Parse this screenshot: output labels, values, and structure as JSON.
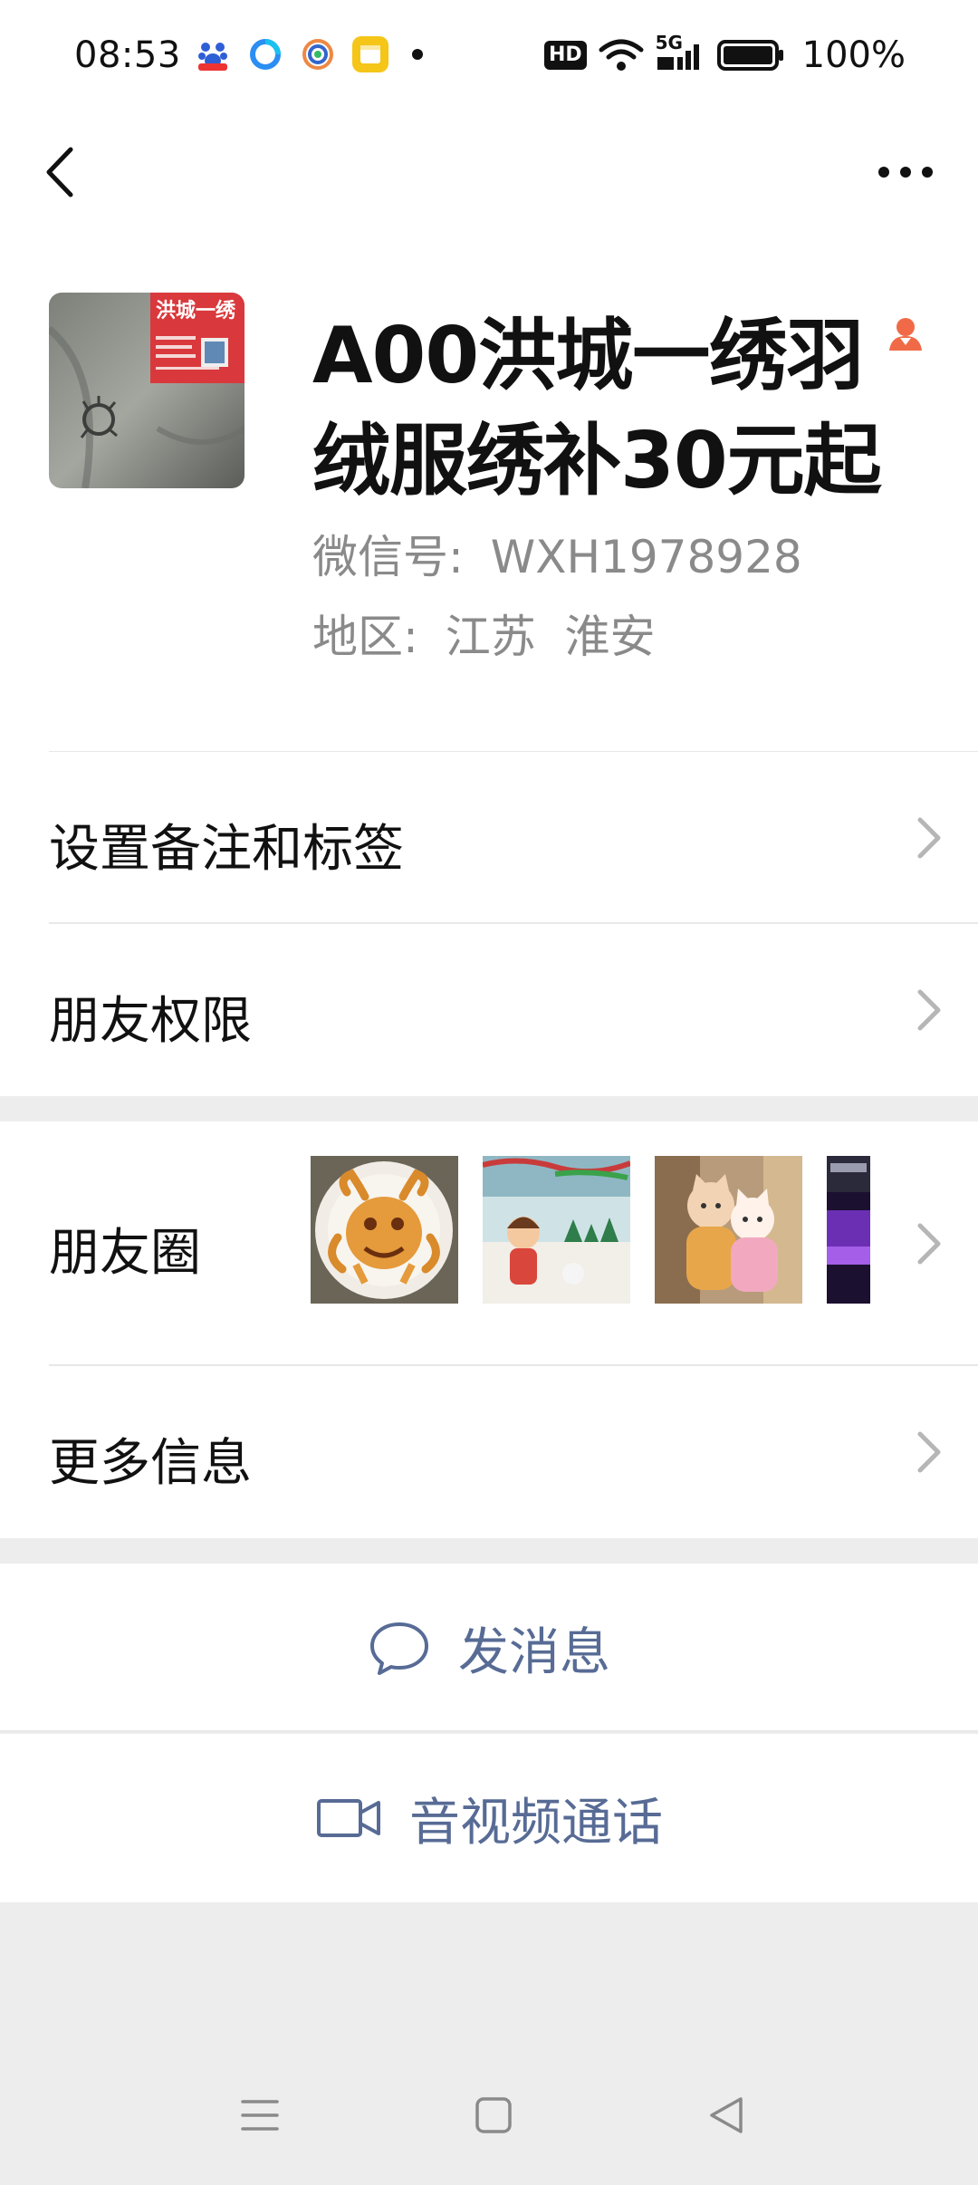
{
  "status_bar": {
    "time": "08:53",
    "network": "5G",
    "hd": "HD",
    "battery": "100%"
  },
  "profile": {
    "name": "A00洪城一绣羽绒服绣补30元起",
    "wechat_id_label": "微信号:",
    "wechat_id": "WXH1978928",
    "region_label": "地区:",
    "region": "江苏  淮安",
    "avatar_text": "洪城一绣"
  },
  "menu": {
    "remarks": "设置备注和标签",
    "permissions": "朋友权限",
    "moments": "朋友圈",
    "more_info": "更多信息"
  },
  "actions": {
    "message": "发消息",
    "call": "音视频通话"
  },
  "colors": {
    "link": "#576b95",
    "gender_icon": "#f06a47"
  }
}
